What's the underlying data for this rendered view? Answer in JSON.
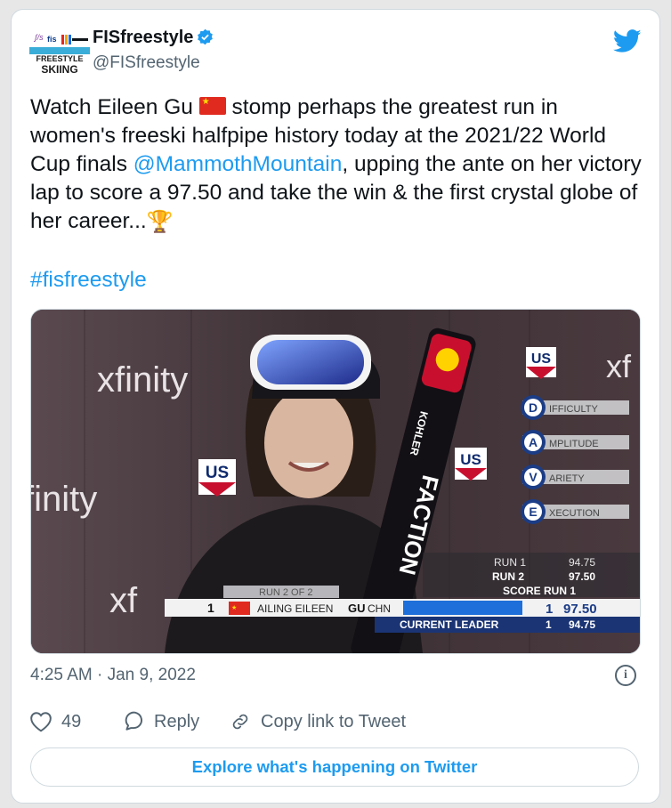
{
  "tweet": {
    "author_name": "FISfreestyle",
    "author_handle": "@FISfreestyle",
    "avatar_text": {
      "top": "FREESTYLE",
      "bottom": "SKIING"
    },
    "text_parts": {
      "p1": "Watch Eileen Gu ",
      "p2": " stomp perhaps the greatest run in women's freeski halfpipe history today at the 2021/22 World Cup finals ",
      "mention": "@MammothMountain",
      "p3": ", upping the ante on her victory lap to score a 97.50 and take the win & the first crystal globe of her career...",
      "trophy": "🏆"
    },
    "hashtag": "#fisfreestyle",
    "timestamp": "4:25 AM · Jan 9, 2022",
    "likes": "49",
    "reply_label": "Reply",
    "copy_label": "Copy link to Tweet",
    "explore_label": "Explore what's happening on Twitter"
  },
  "video": {
    "sponsor": "xfinity",
    "sponsor_partial": "finity",
    "sponsor_partial2": "xf",
    "ski_text": "FACTION",
    "ski_brand": "KOHLER",
    "us_logo": "US",
    "criteria": [
      {
        "letter": "D",
        "rest": "IFFICULTY"
      },
      {
        "letter": "A",
        "rest": "MPLITUDE"
      },
      {
        "letter": "V",
        "rest": "ARIETY"
      },
      {
        "letter": "E",
        "rest": "XECUTION"
      }
    ],
    "runs": [
      {
        "label": "RUN 1",
        "score": "94.75"
      },
      {
        "label": "RUN 2",
        "score": "97.50"
      }
    ],
    "score_run_label": "SCORE RUN 1",
    "run_of": "RUN 2 OF 2",
    "rank": "1",
    "athlete": "AILING EILEEN",
    "athlete_bold": "GU",
    "nation": "CHN",
    "current_rank": "1",
    "current_score": "97.50",
    "leader_label": "CURRENT LEADER",
    "leader_rank": "1",
    "leader_score": "94.75"
  },
  "colors": {
    "accent": "#1d9bf0",
    "text": "#0f1419",
    "muted": "#536471",
    "border": "#cfd9de",
    "china_red": "#e02a20"
  }
}
